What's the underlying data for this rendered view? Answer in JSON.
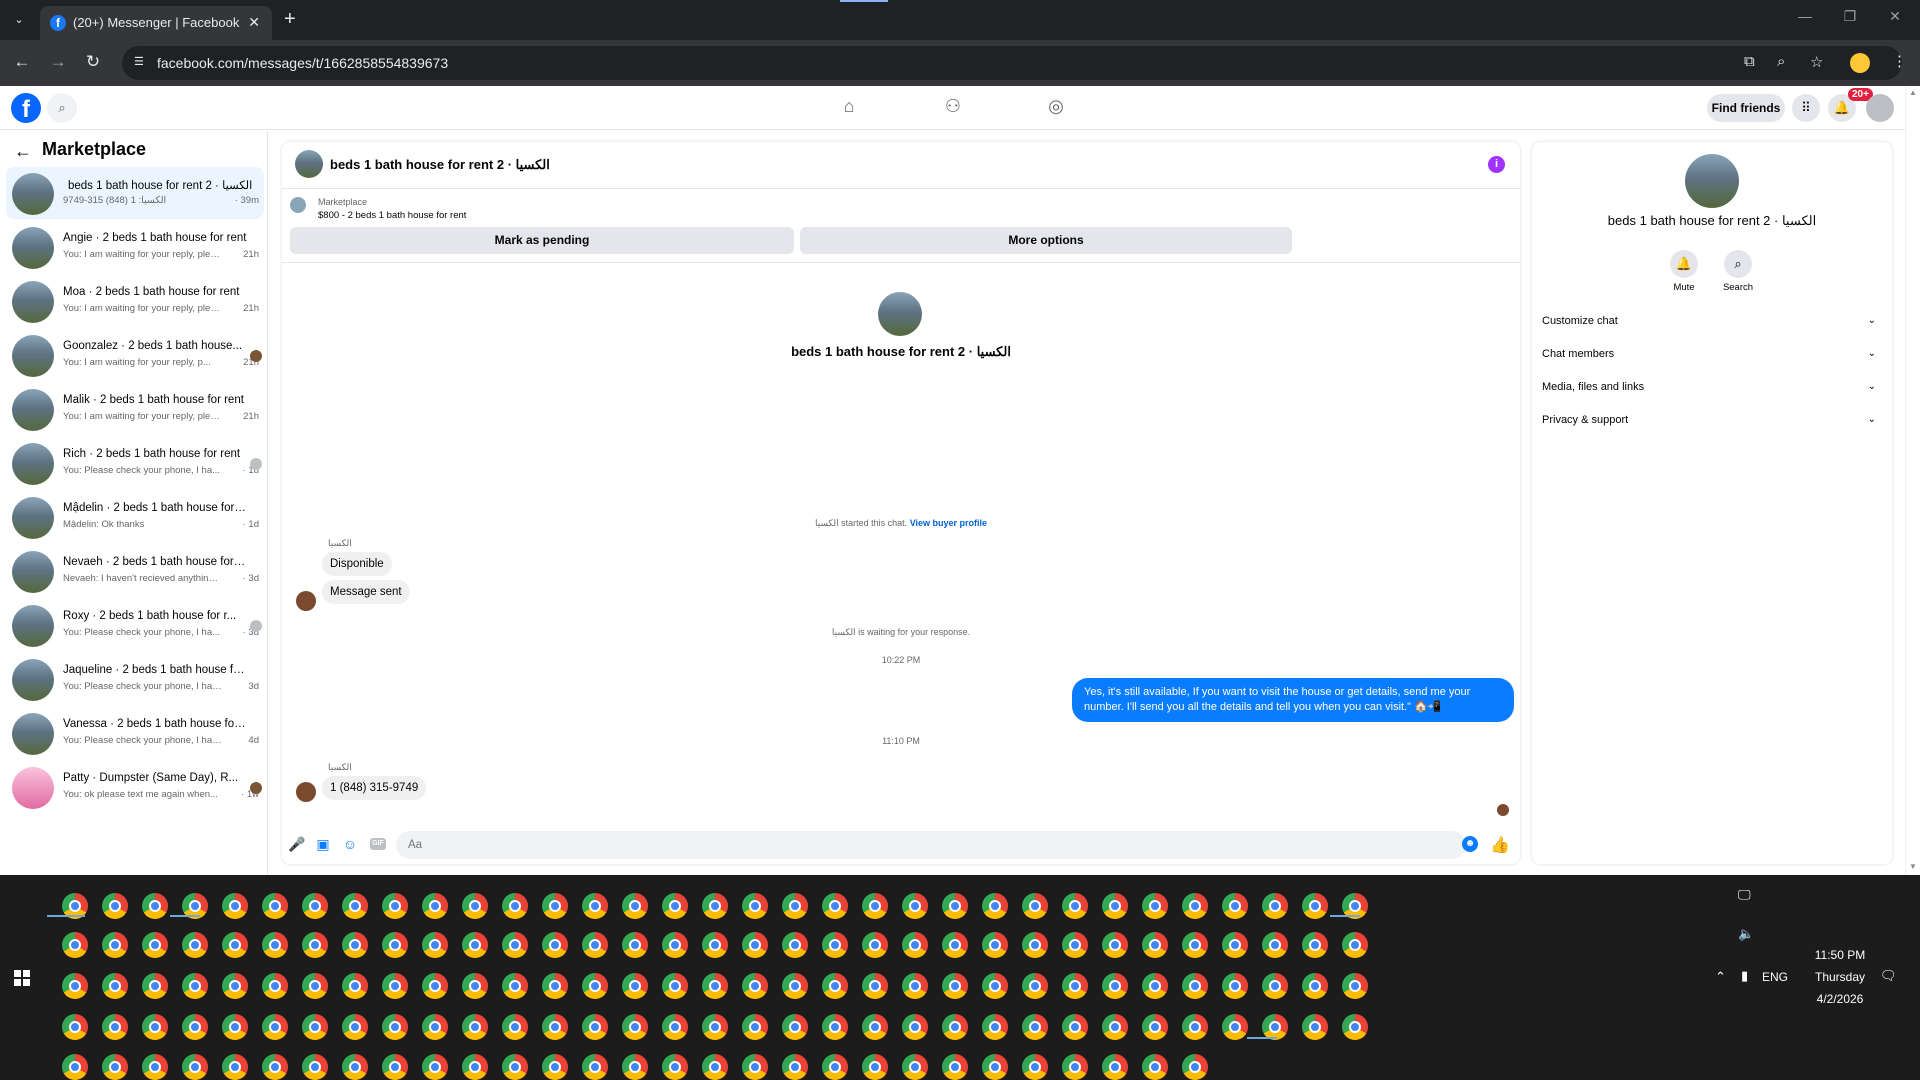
{
  "browser": {
    "tab_title": "(20+) Messenger | Facebook",
    "url": "facebook.com/messages/t/1662858554839673"
  },
  "header": {
    "find_friends": "Find friends",
    "notif_count": "20+"
  },
  "left": {
    "title": "Marketplace",
    "conversations": [
      {
        "name": "beds 1 bath house for rent 2 · الكسيا",
        "preview": "9749-315 (848) 1 :الكسيا",
        "time": "· 39m",
        "active": true,
        "seen": "none"
      },
      {
        "name": "Angie · 2 beds 1 bath house for rent",
        "preview": "You: I am waiting for your reply, plea...",
        "time": "21h",
        "seen": "none"
      },
      {
        "name": "Moa · 2 beds 1 bath house for rent",
        "preview": "You: I am waiting for your reply, plea...",
        "time": "21h",
        "seen": "none"
      },
      {
        "name": "Goonzalez · 2 beds 1 bath house...",
        "preview": "You: I am waiting for your reply, p...",
        "time": "21h",
        "seen": "brown"
      },
      {
        "name": "Malik · 2 beds 1 bath house for rent",
        "preview": "You: I am waiting for your reply, plea...",
        "time": "21h",
        "seen": "none"
      },
      {
        "name": "Rich · 2 beds 1 bath house for rent",
        "preview": "You: Please check your phone, I ha...",
        "time": "· 1d",
        "seen": "grey"
      },
      {
        "name": "Mậdelin · 2 beds 1 bath house for r...",
        "preview": "Mậdelin: Ok thanks",
        "time": "· 1d",
        "seen": "none"
      },
      {
        "name": "Nevaeh · 2 beds 1 bath house for r...",
        "preview": "Nevaeh: I haven't recieved anything yet",
        "time": "· 3d",
        "seen": "none"
      },
      {
        "name": "Roxy · 2 beds 1 bath house for r...",
        "preview": "You: Please check your phone, I ha...",
        "time": "· 3d",
        "seen": "grey"
      },
      {
        "name": "Jaqueline · 2 beds 1 bath house for...",
        "preview": "You: Please check your phone, I have t...",
        "time": "3d",
        "seen": "none"
      },
      {
        "name": "Vanessa · 2 beds 1 bath house for r...",
        "preview": "You: Please check your phone, I have t...",
        "time": "4d",
        "seen": "none"
      },
      {
        "name": "Patty · Dumpster (Same Day), R...",
        "preview": "You: ok please text me again when...",
        "time": "· 1w",
        "seen": "brown",
        "pink": true
      }
    ]
  },
  "chat": {
    "title": "beds 1 bath house for rent 2 · الكسيا",
    "marketplace_label": "Marketplace",
    "listing": "$800 - 2 beds 1 bath house for rent",
    "mark_pending": "Mark as pending",
    "more_options": "More options",
    "center_name": "beds 1 bath house for rent 2 · الكسيا",
    "started_text": "الكسيا started this chat.",
    "view_profile": "View buyer profile",
    "sender1": "الكسيا",
    "msg1": "Disponible",
    "msg2": "Message sent",
    "waiting": "الكسيا is waiting for your response.",
    "time1": "10:22 PM",
    "reply": "Yes, it's still available, If you want to visit the house or get details, send me your number. I'll send you all the details and tell you when you can visit.\" 🏠📲",
    "time2": "11:10 PM",
    "sender2": "الكسيا",
    "msg3": "1 (848) 315-9749",
    "placeholder": "Aa"
  },
  "right": {
    "name": "beds 1 bath house for rent 2 · الكسيا",
    "mute": "Mute",
    "search": "Search",
    "sections": [
      "Customize chat",
      "Chat members",
      "Media, files and links",
      "Privacy & support"
    ]
  },
  "taskbar": {
    "lang": "ENG",
    "time": "11:50 PM",
    "day": "Thursday",
    "date": "4/2/2026"
  },
  "colors": {
    "fb_blue": "#0866ff",
    "bubble_blue": "#0a7cff",
    "info_purple": "#a033ff"
  }
}
